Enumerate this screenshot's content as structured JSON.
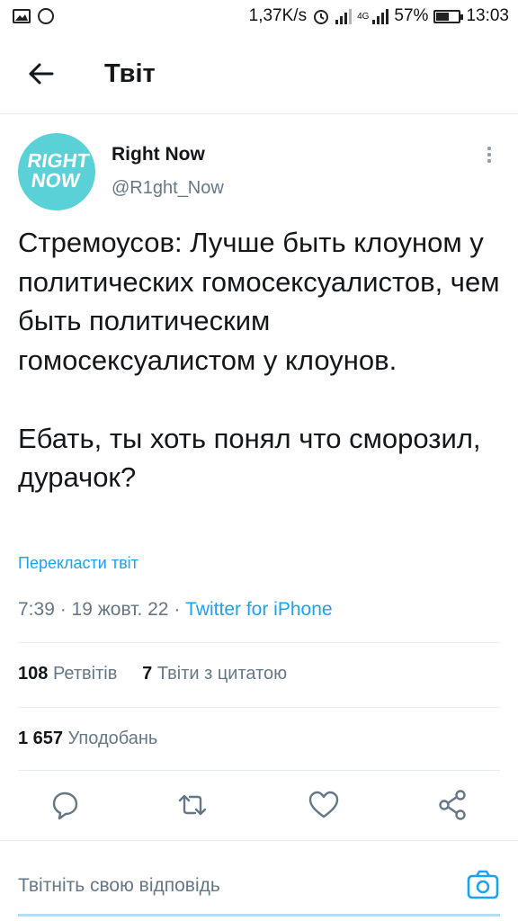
{
  "status_bar": {
    "speed": "1,37K/s",
    "network": "4G",
    "battery_percent": "57%",
    "battery_level": 0.57,
    "time": "13:03",
    "icons": [
      "image-icon",
      "message-icon",
      "alarm-icon",
      "wifi-icon",
      "signal-icon",
      "signal-4g-icon",
      "battery-icon"
    ]
  },
  "header": {
    "title": "Твіт",
    "back_icon": "arrow-left-icon"
  },
  "author": {
    "name": "Right Now",
    "handle": "@R1ght_Now",
    "avatar_text_line1": "RIGHT",
    "avatar_text_line2": "NOW",
    "avatar_color": "#5ad1d6"
  },
  "tweet": {
    "text": "Стремоусов: Лучше быть клоуном у политических гомосексуалистов, чем быть политическим гомосексуалистом у клоунов.\n\nЕбать, ты хоть понял что сморозил, дурачок?",
    "translate_label": "Перекласти твіт",
    "time": "7:39",
    "date": "19 жовт. 22",
    "separator": " · ",
    "source": "Twitter for iPhone"
  },
  "stats": {
    "retweets_count": "108",
    "retweets_label": "Ретвітів",
    "quotes_count": "7",
    "quotes_label": "Твіти з цитатою",
    "likes_count": "1 657",
    "likes_label": "Уподобань"
  },
  "actions": {
    "reply": "comment-icon",
    "retweet": "retweet-icon",
    "like": "heart-icon",
    "share": "share-icon"
  },
  "reply_box": {
    "placeholder": "Твітніть свою відповідь",
    "camera_icon": "camera-icon"
  },
  "colors": {
    "accent": "#1da1f2",
    "secondary_text": "#657786",
    "divider": "#e6ecf0"
  }
}
